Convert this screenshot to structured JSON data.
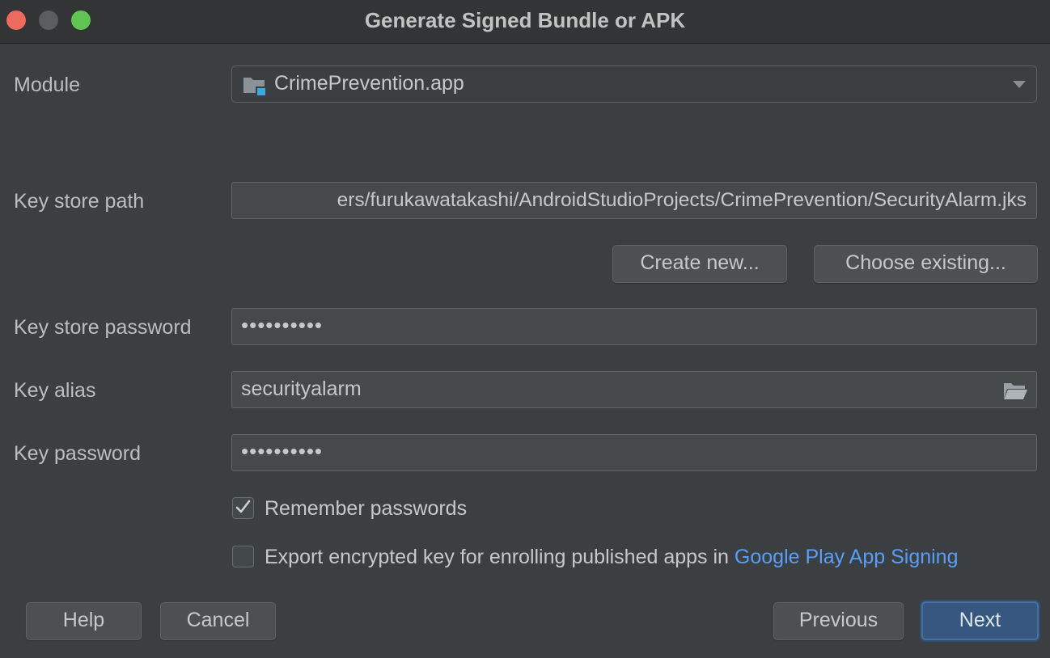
{
  "window": {
    "title": "Generate Signed Bundle or APK"
  },
  "module": {
    "label": "Module",
    "value": "CrimePrevention.app",
    "icon": "module-folder-icon"
  },
  "keystore": {
    "path_label": "Key store path",
    "path_value": "ers/furukawatakashi/AndroidStudioProjects/CrimePrevention/SecurityAlarm.jks",
    "create_new_label": "Create new...",
    "choose_existing_label": "Choose existing...",
    "password_label": "Key store password",
    "password_value": "••••••••••"
  },
  "key": {
    "alias_label": "Key alias",
    "alias_value": "securityalarm",
    "password_label": "Key password",
    "password_value": "••••••••••"
  },
  "options": {
    "remember_label": "Remember passwords",
    "remember_checked": true,
    "export_label": "Export encrypted key for enrolling published apps in ",
    "export_link": "Google Play App Signing",
    "export_checked": false
  },
  "footer": {
    "help_label": "Help",
    "cancel_label": "Cancel",
    "previous_label": "Previous",
    "next_label": "Next"
  },
  "colors": {
    "background": "#3c3f41",
    "field": "#45494a",
    "primary_button": "#365880",
    "link": "#589df6"
  }
}
